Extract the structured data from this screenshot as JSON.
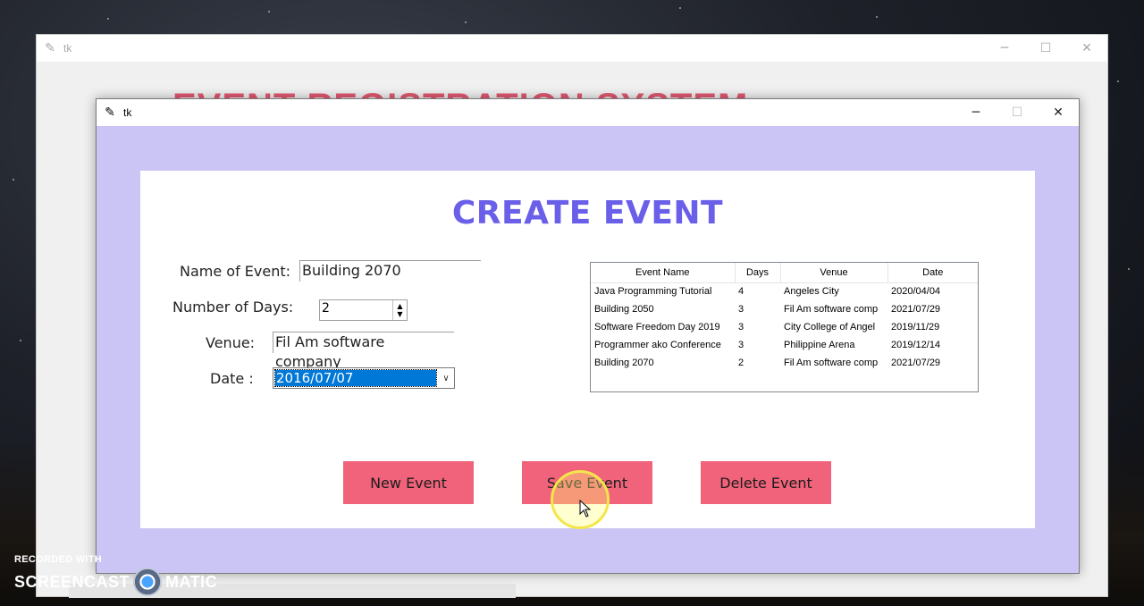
{
  "background_window": {
    "title": "tk",
    "heading": "EVENT REGISTRATION SYSTEM"
  },
  "window": {
    "title": "tk",
    "minimize": "─",
    "maximize": "☐",
    "close": "✕"
  },
  "form": {
    "heading": "CREATE EVENT",
    "name_label": "Name of Event:",
    "name_value": "Building 2070",
    "days_label": "Number of Days:",
    "days_value": "2",
    "venue_label": "Venue:",
    "venue_value": "Fil Am software company",
    "date_label": "Date :",
    "date_value": "2016/07/07"
  },
  "table": {
    "columns": [
      "Event Name",
      "Days",
      "Venue",
      "Date"
    ],
    "rows": [
      [
        "Java Programming Tutorial",
        "4",
        "Angeles City",
        "2020/04/04"
      ],
      [
        "Building 2050",
        "3",
        "Fil Am software comp",
        "2021/07/29"
      ],
      [
        "Software Freedom Day 2019",
        "3",
        "City College of Angel",
        "2019/11/29"
      ],
      [
        "Programmer ako Conference",
        "3",
        "Philippine Arena",
        "2019/12/14"
      ],
      [
        "Building 2070",
        "2",
        "Fil Am software comp",
        "2021/07/29"
      ]
    ]
  },
  "buttons": {
    "new": "New Event",
    "save": "Save Event",
    "delete": "Delete Event"
  },
  "watermark": {
    "line1": "RECORDED WITH",
    "left": "SCREENCAST",
    "right": "MATIC"
  },
  "colors": {
    "heading": "#6a5fe8",
    "button": "#f0637a",
    "window_bg": "#cac5f5",
    "selection": "#0078d7"
  }
}
